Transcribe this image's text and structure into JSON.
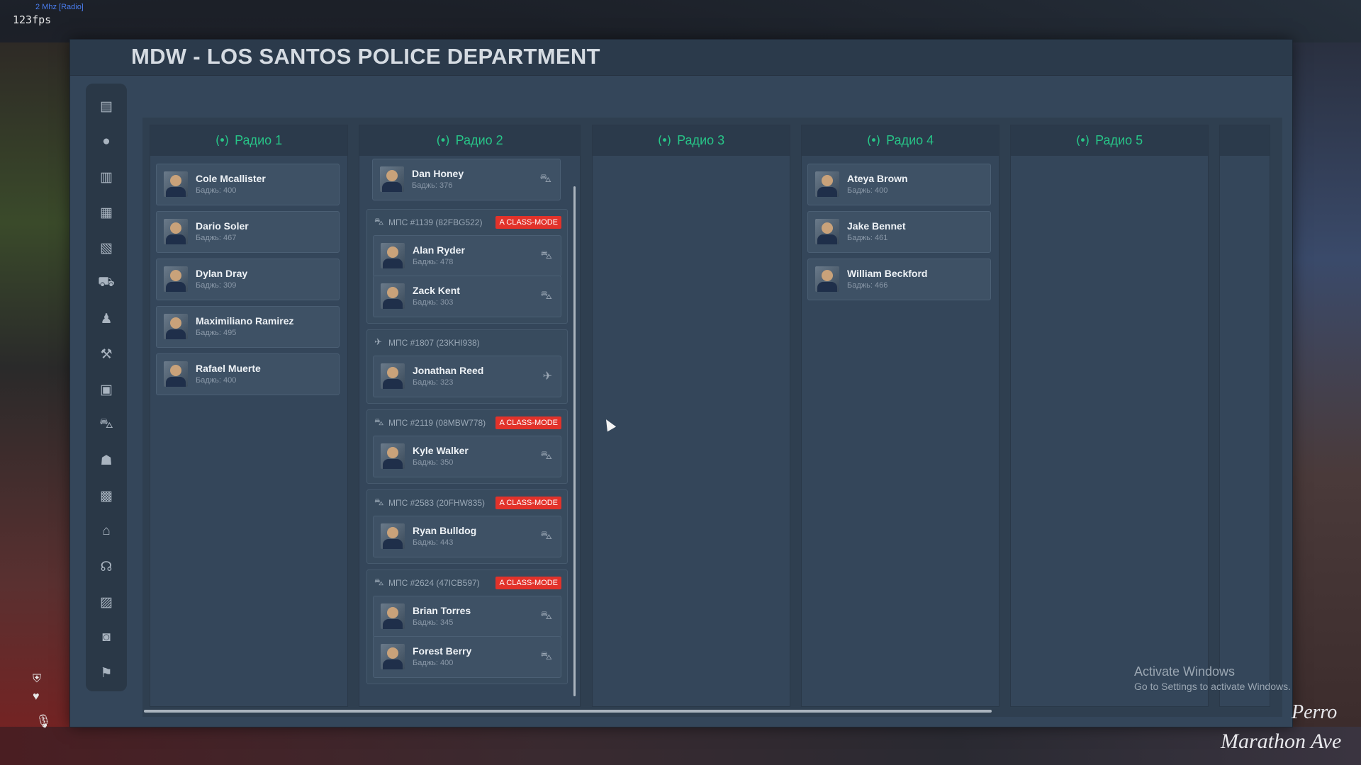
{
  "overlay": {
    "radio_text": "2 Mhz [Radio]",
    "fps_text": "123fps"
  },
  "header": {
    "title": "MDW - LOS SANTOS POLICE DEPARTMENT"
  },
  "sidebar": {
    "items": [
      {
        "icon": "newspaper-icon",
        "glyph": "▤"
      },
      {
        "icon": "person-icon",
        "glyph": "●"
      },
      {
        "icon": "document-icon",
        "glyph": "▥"
      },
      {
        "icon": "file-icon",
        "glyph": "▦"
      },
      {
        "icon": "clipboard-icon",
        "glyph": "▧"
      },
      {
        "icon": "car-crash-icon",
        "glyph": "⛟"
      },
      {
        "icon": "user-lock-icon",
        "glyph": "♟"
      },
      {
        "icon": "gavel-icon",
        "glyph": "⚒"
      },
      {
        "icon": "briefcase-icon",
        "glyph": "▣"
      },
      {
        "icon": "car-icon",
        "glyph": "⛍"
      },
      {
        "icon": "users-icon",
        "glyph": "☗"
      },
      {
        "icon": "building-icon",
        "glyph": "▩"
      },
      {
        "icon": "home-icon",
        "glyph": "⌂"
      },
      {
        "icon": "headset-icon",
        "glyph": "☊"
      },
      {
        "icon": "images-icon",
        "glyph": "▨"
      },
      {
        "icon": "camera-icon",
        "glyph": "◙"
      },
      {
        "icon": "flag-checkered-icon",
        "glyph": "⚑"
      }
    ]
  },
  "columns": [
    {
      "title": "Радио 1",
      "units": [
        {
          "name": "Cole Mcallister",
          "badge": "Баджь: 400"
        },
        {
          "name": "Dario Soler",
          "badge": "Баджь: 467"
        },
        {
          "name": "Dylan Dray",
          "badge": "Баджь: 309"
        },
        {
          "name": "Maximiliano Ramirez",
          "badge": "Баджь: 495"
        },
        {
          "name": "Rafael Muerte",
          "badge": "Баджь: 400"
        }
      ]
    },
    {
      "title": "Радио 2",
      "top_unit": {
        "name": "Dan Honey",
        "badge": "Баджь: 376",
        "vehicle_icon": "car-icon"
      },
      "groups": [
        {
          "label": "МПС #1139 (82FBG522)",
          "icon": "car-icon",
          "tag": "A CLASS-MODE",
          "units": [
            {
              "name": "Alan Ryder",
              "badge": "Баджь: 478",
              "vehicle_icon": "car-icon"
            },
            {
              "name": "Zack Kent",
              "badge": "Баджь: 303",
              "vehicle_icon": "car-icon"
            }
          ]
        },
        {
          "label": "МПС #1807 (23KHI938)",
          "icon": "helicopter-icon",
          "tag": "",
          "units": [
            {
              "name": "Jonathan Reed",
              "badge": "Баджь: 323",
              "vehicle_icon": "helicopter-icon"
            }
          ]
        },
        {
          "label": "МПС #2119 (08MBW778)",
          "icon": "car-icon",
          "tag": "A CLASS-MODE",
          "units": [
            {
              "name": "Kyle Walker",
              "badge": "Баджь: 350",
              "vehicle_icon": "car-icon"
            }
          ]
        },
        {
          "label": "МПС #2583 (20FHW835)",
          "icon": "car-icon",
          "tag": "A CLASS-MODE",
          "units": [
            {
              "name": "Ryan Bulldog",
              "badge": "Баджь: 443",
              "vehicle_icon": "car-icon"
            }
          ]
        },
        {
          "label": "МПС #2624 (47ICB597)",
          "icon": "car-icon",
          "tag": "A CLASS-MODE",
          "units": [
            {
              "name": "Brian Torres",
              "badge": "Баджь: 345",
              "vehicle_icon": "car-icon"
            },
            {
              "name": "Forest Berry",
              "badge": "Баджь: 400",
              "vehicle_icon": "car-icon"
            }
          ]
        }
      ]
    },
    {
      "title": "Радио 3",
      "units": []
    },
    {
      "title": "Радио 4",
      "units": [
        {
          "name": "Ateya Brown",
          "badge": "Баджь: 400"
        },
        {
          "name": "Jake Bennet",
          "badge": "Баджь: 461"
        },
        {
          "name": "William Beckford",
          "badge": "Баджь: 466"
        }
      ]
    },
    {
      "title": "Радио 5",
      "units": []
    }
  ],
  "windows_watermark": {
    "line1": "Activate Windows",
    "line2": "Go to Settings to activate Windows."
  },
  "location": {
    "area": "Perro",
    "street": "Marathon Ave"
  }
}
